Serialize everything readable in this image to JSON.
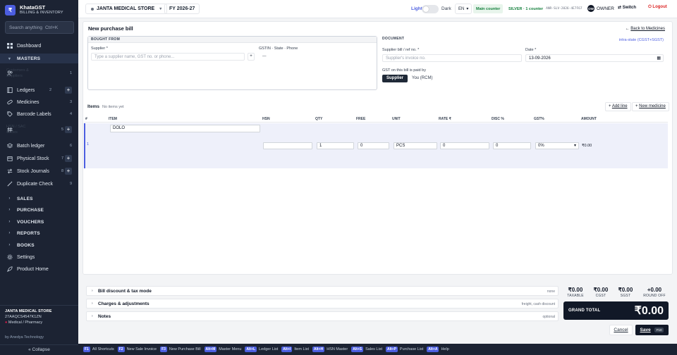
{
  "app": {
    "name": "KhataGST",
    "subtitle": "BILLING & INVENTORY",
    "logo": "₹"
  },
  "search": {
    "label": "Search anything",
    "shortcut": "Ctrl+K"
  },
  "sidebar": {
    "items": [
      {
        "label": "Dashboard",
        "icon": "grid-icon"
      },
      {
        "label": "MASTERS",
        "section": true
      },
      {
        "label": "Customers & Suppliers",
        "count": "1",
        "icon": "users-icon"
      },
      {
        "label": "Ledgers",
        "count": "2",
        "plus": "+",
        "icon": "book-icon"
      },
      {
        "label": "Medicines",
        "count": "3",
        "icon": "pill-icon"
      },
      {
        "label": "Barcode Labels",
        "count": "4",
        "icon": "tag-icon"
      },
      {
        "label": "HSN / SAC Codes",
        "count": "5",
        "plus": "+",
        "icon": "hash-icon"
      },
      {
        "label": "Batch ledger",
        "count": "6",
        "icon": "layers-icon"
      },
      {
        "label": "Physical Stock",
        "count": "7",
        "plus": "+",
        "icon": "box-icon"
      },
      {
        "label": "Stock Journals",
        "count": "8",
        "plus": "+",
        "icon": "arrows-icon"
      },
      {
        "label": "Duplicate Check",
        "count": "9",
        "icon": "wand-icon"
      },
      {
        "label": "SALES",
        "section": true
      },
      {
        "label": "PURCHASE",
        "section": true
      },
      {
        "label": "VOUCHERS",
        "section": true
      },
      {
        "label": "REPORTS",
        "section": true
      },
      {
        "label": "BOOKS",
        "section": true
      },
      {
        "label": "Settings",
        "icon": "gear-icon"
      },
      {
        "label": "Product Home",
        "icon": "rocket-icon"
      }
    ],
    "footer": {
      "store": "JANTA MEDICAL STORE",
      "gstin": "27AAQCS4547K1ZN",
      "category": "Medical / Pharmacy",
      "by": "by Anedya Technology",
      "collapse": "« Collapse"
    }
  },
  "topbar": {
    "store": "JANTA MEDICAL STORE",
    "fy": "FY 2026-27",
    "light": "Light",
    "dark": "Dark",
    "lang": "EN",
    "counter": "Main counter",
    "license_tier": "SILVER · 1 counter",
    "license_key": "ANR-SLV-2026-4E7F67",
    "user_initials": "OW",
    "user": "OWNER",
    "switch": "Switch",
    "logout": "Logout"
  },
  "page": {
    "title": "New purchase bill",
    "back": "Back to Medicines",
    "supplier_card": {
      "head": "BOUGHT FROM",
      "supplier_label": "Supplier *",
      "supplier_placeholder": "Type a supplier name, GST no. or phone...",
      "add": "+",
      "gstin_label": "GSTIN · State · Phone",
      "gstin_value": "—"
    },
    "doc_card": {
      "head": "DOCUMENT",
      "tax_mode": "intra-state (CGST+SGST)",
      "bill_label": "Supplier bill / ref no. *",
      "bill_placeholder": "Supplier's invoice no.",
      "date_label": "Date *",
      "date_value": "13-09-2026",
      "paid_label": "GST on this bill is paid by",
      "paid_on": "Supplier",
      "paid_off": "You (RCM)"
    },
    "items": {
      "title": "Items",
      "sub": "No items yet",
      "add_line": "Add line",
      "new_medicine": "New medicine",
      "columns": [
        "#",
        "ITEM",
        "HSN",
        "QTY",
        "FREE",
        "UNIT",
        "RATE ₹",
        "DISC %",
        "GST%",
        "AMOUNT"
      ],
      "row": {
        "num": "1",
        "item": "DOLO",
        "hsn": "",
        "qty": "1",
        "free": "0",
        "unit": "PCS",
        "rate": "0",
        "disc": "0",
        "gst": "0%",
        "amount": "₹0.00"
      }
    },
    "sections": [
      {
        "title": "Bill discount & tax mode",
        "hint": "none"
      },
      {
        "title": "Charges & adjustments",
        "hint": "freight, cash discount"
      },
      {
        "title": "Notes",
        "hint": "optional"
      }
    ],
    "totals": {
      "taxable": "₹0.00",
      "taxable_label": "TAXABLE",
      "cgst": "₹0.00",
      "cgst_label": "CGST",
      "sgst": "₹0.00",
      "sgst_label": "SGST",
      "round": "+0.00",
      "round_label": "ROUND OFF",
      "grand_label": "GRAND TOTAL",
      "grand": "₹0.00"
    },
    "cancel": "Cancel",
    "save": "Save",
    "save_key": "F10"
  },
  "shortcuts": [
    {
      "key": "F1",
      "label": "All Shortcuts"
    },
    {
      "key": "F2",
      "label": "New Sale Invoice"
    },
    {
      "key": "F3",
      "label": "New Purchase Bill"
    },
    {
      "key": "Alt+M",
      "label": "Master Menu"
    },
    {
      "key": "Alt+L",
      "label": "Ledger List"
    },
    {
      "key": "Alt+I",
      "label": "Item List"
    },
    {
      "key": "Alt+H",
      "label": "HSN Master"
    },
    {
      "key": "Alt+S",
      "label": "Sales List"
    },
    {
      "key": "Alt+P",
      "label": "Purchase List"
    },
    {
      "key": "Alt+A",
      "label": "Help"
    }
  ]
}
